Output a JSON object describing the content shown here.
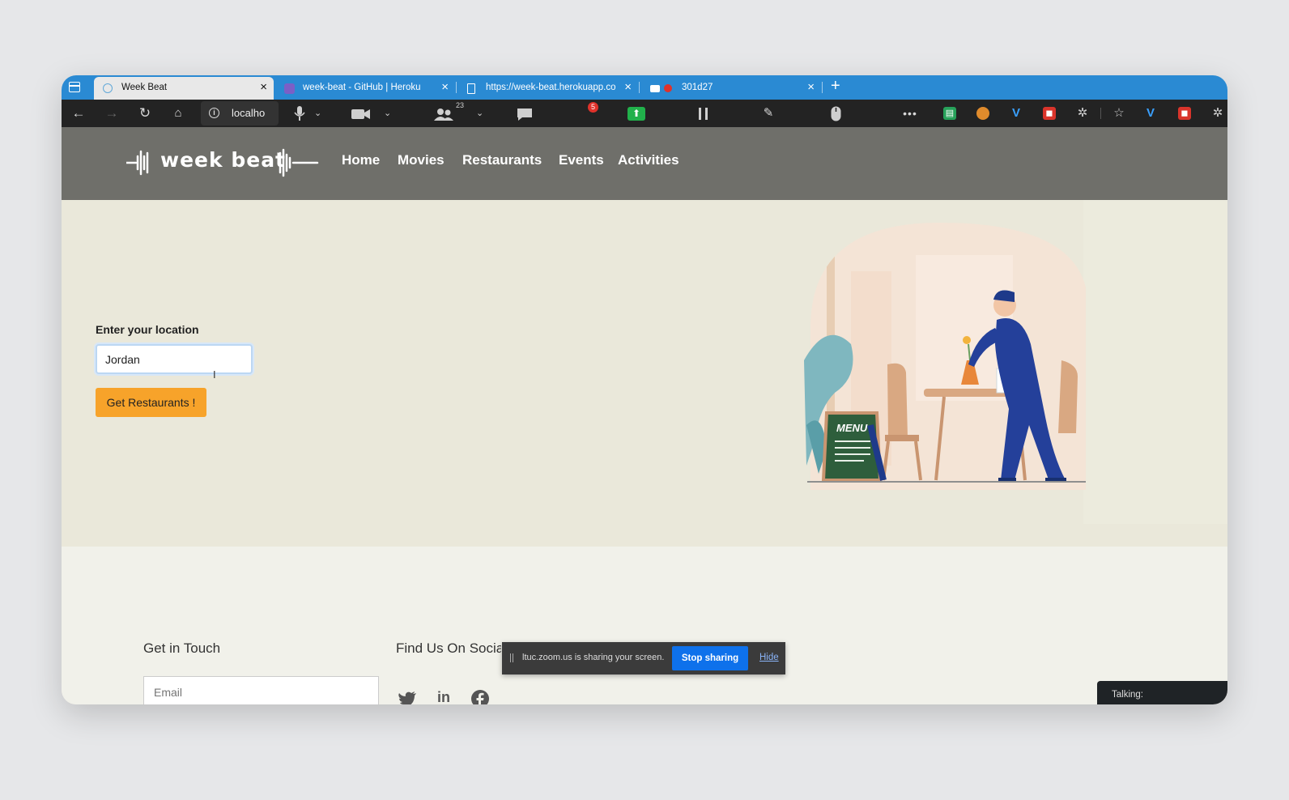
{
  "browser": {
    "tabs": [
      {
        "title": "Week Beat",
        "active": true,
        "icon": "react-icon"
      },
      {
        "title": "week-beat - GitHub | Heroku",
        "active": false,
        "icon": "heroku-icon"
      },
      {
        "title": "https://week-beat.herokuapp.co",
        "active": false,
        "icon": "page-icon"
      },
      {
        "title": "301d27",
        "active": false,
        "icon": "zoom-recording-icon"
      }
    ],
    "close_glyph": "×",
    "new_tab_glyph": "+",
    "address": "localho"
  },
  "zoom_toolbar": {
    "participants_count": "23",
    "chat_badge": "5"
  },
  "site": {
    "logo_text": "week beat",
    "nav": [
      "Home",
      "Movies",
      "Restaurants",
      "Events",
      "Activities"
    ]
  },
  "hero": {
    "location_label": "Enter your location",
    "location_value": "Jordan",
    "submit_label": "Get Restaurants !",
    "menu_board_text": "MENU"
  },
  "footer": {
    "contact_title": "Get in Touch",
    "social_title": "Find Us On Social",
    "email_placeholder": "Email",
    "social_icons": [
      "twitter-icon",
      "linkedin-icon",
      "facebook-icon"
    ]
  },
  "zoom_share": {
    "message": "ltuc.zoom.us is sharing your screen.",
    "stop_label": "Stop sharing",
    "hide_label": "Hide"
  },
  "talking_label": "Talking:",
  "colors": {
    "tab_bar": "#2a8ad3",
    "site_header": "#6f6f6a",
    "hero_bg": "#eae8da",
    "cta": "#f7a32a",
    "stop_share": "#0e71eb"
  }
}
